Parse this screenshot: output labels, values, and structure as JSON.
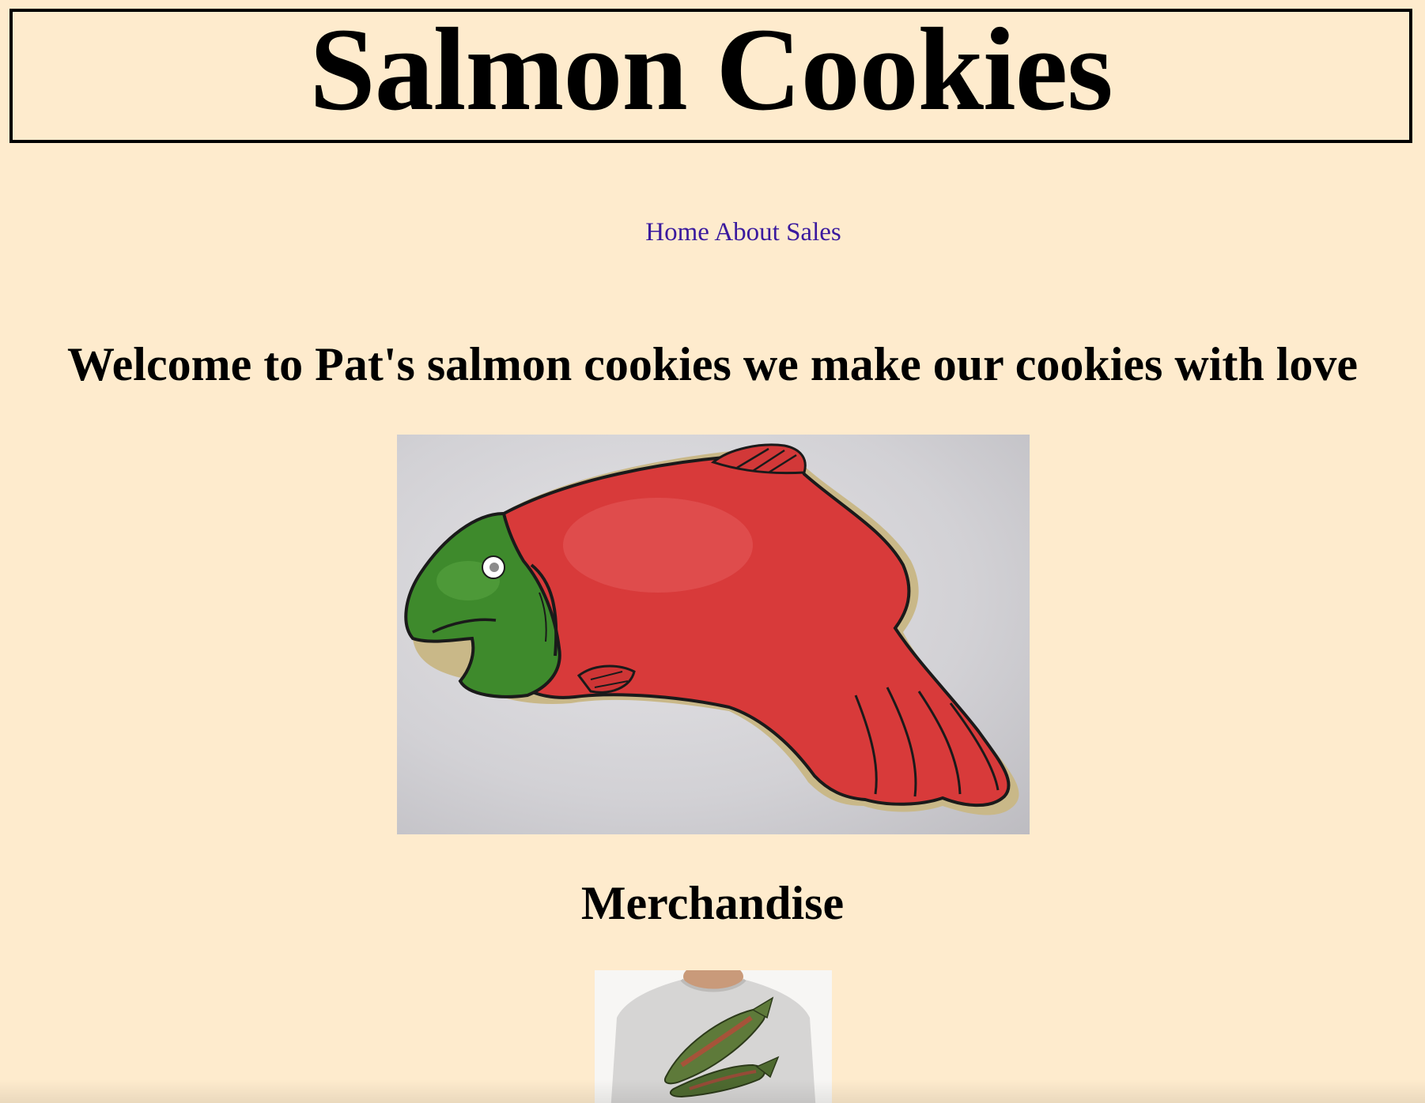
{
  "header": {
    "title": "Salmon Cookies"
  },
  "nav": {
    "items": [
      {
        "label": "Home"
      },
      {
        "label": "About"
      },
      {
        "label": "Sales"
      }
    ]
  },
  "main": {
    "welcome_heading": "Welcome to Pat's salmon cookies we make our cookies with love",
    "hero_image": {
      "icon": "salmon-cookie-image"
    },
    "merch_heading": "Merchandise",
    "merch_image": {
      "icon": "salmon-tshirt-image"
    }
  },
  "colors": {
    "background": "#FEEBCD",
    "link": "#3A1A9E",
    "text": "#000000"
  }
}
